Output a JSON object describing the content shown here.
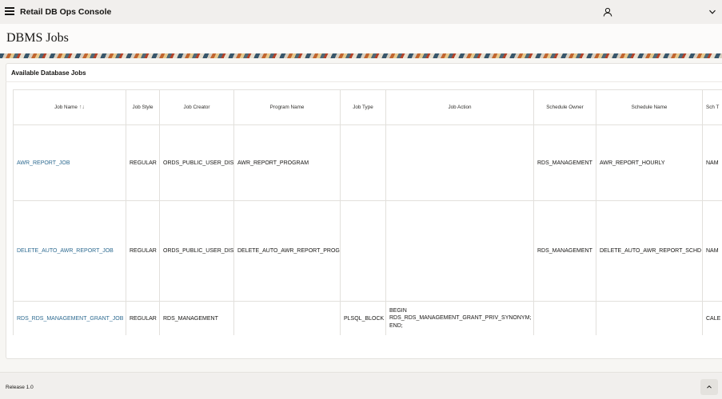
{
  "app": {
    "title": "Retail DB Ops Console"
  },
  "page": {
    "title": "DBMS Jobs"
  },
  "region": {
    "title": "Available Database Jobs"
  },
  "table": {
    "columns": {
      "job_name": "Job Name",
      "job_style": "Job Style",
      "job_creator": "Job Creator",
      "program_name": "Program Name",
      "job_type": "Job Type",
      "job_action": "Job Action",
      "schedule_owner": "Schedule Owner",
      "schedule_name": "Schedule Name",
      "schedule_type": "Sch T"
    },
    "rows": [
      {
        "job_name": "AWR_REPORT_JOB",
        "job_style": "REGULAR",
        "job_creator": "ORDS_PUBLIC_USER_DIS",
        "program_name": "AWR_REPORT_PROGRAM",
        "job_type": "",
        "job_action": "",
        "schedule_owner": "RDS_MANAGEMENT",
        "schedule_name": "AWR_REPORT_HOURLY",
        "schedule_type": "NAM"
      },
      {
        "job_name": "DELETE_AUTO_AWR_REPORT_JOB",
        "job_style": "REGULAR",
        "job_creator": "ORDS_PUBLIC_USER_DIS",
        "program_name": "DELETE_AUTO_AWR_REPORT_PROG",
        "job_type": "",
        "job_action": "",
        "schedule_owner": "RDS_MANAGEMENT",
        "schedule_name": "DELETE_AUTO_AWR_REPORT_SCHD",
        "schedule_type": "NAM"
      },
      {
        "job_name": "RDS_RDS_MANAGEMENT_GRANT_JOB",
        "job_style": "REGULAR",
        "job_creator": "RDS_MANAGEMENT",
        "program_name": "",
        "job_type": "PLSQL_BLOCK",
        "job_action": "BEGIN\nRDS_RDS_MANAGEMENT_GRANT_PRIV_SYNONYM;\nEND;",
        "schedule_owner": "",
        "schedule_name": "",
        "schedule_type": "CALE"
      }
    ]
  },
  "footer": {
    "release": "Release 1.0"
  },
  "icons": {
    "menu": "hamburger-menu-icon",
    "user": "user-icon",
    "dropdown": "chevron-down-icon",
    "sort": "sort-icon",
    "scroll_top": "chevron-up-icon"
  }
}
